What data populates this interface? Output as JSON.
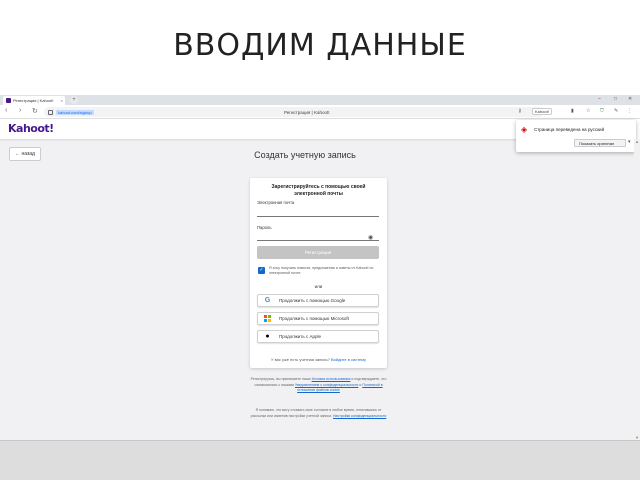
{
  "slide": {
    "title": "ВВОДИМ ДАННЫЕ"
  },
  "browser": {
    "tab_title": "Регистрация | Kahoot!",
    "tab_close": "×",
    "new_tab": "+",
    "url": "kahoot.com/signup",
    "page_title": "Регистрация | Kahoot!",
    "nav": {
      "back": "‹",
      "forward": "›",
      "reload": "↻"
    },
    "window_controls": {
      "minimize": "–",
      "maximize": "□",
      "close": "✕"
    },
    "extensions": {
      "translate_label": "Kahoot!"
    }
  },
  "header": {
    "logo": "Kahoot!"
  },
  "back_button": {
    "label": "← назад"
  },
  "main": {
    "heading": "Создать учетную запись"
  },
  "card": {
    "title": "Зарегистрируйтесь с помощью своей электронной почты",
    "email_label": "Электронная почта",
    "password_label": "Пароль",
    "submit_label": "Регистрация",
    "consent_text": "Я хочу получать новости, предложения и советы от Kahoot! по электронной почте.",
    "or_label": "или",
    "google_label": "Продолжить с помощью Google",
    "microsoft_label": "Продолжить с помощью Microsoft",
    "apple_label": "Продолжить с Apple",
    "login_prompt": "У вас уже есть учетная запись?",
    "login_link": "Войдите в систему"
  },
  "legal": {
    "p1_start": "Регистрируясь, вы принимаете наши",
    "p1_link1": "Условия использования",
    "p1_mid": "и подтверждаете, что ознакомились с нашими",
    "p1_link2": "Уведомлением о конфиденциальности",
    "p1_and": "и",
    "p1_link3": "Политикой в отношении файлов cookie",
    "p2_text": "Я понимаю, что могу отозвать свое согласие в любое время, отписавшись от рассылки или изменив настройки учетной записи.",
    "p2_link": "Настройки конфиденциальности"
  },
  "translate_popup": {
    "message": "Страница переведена на русский",
    "option": "Показать оригинал",
    "caret": "▾"
  },
  "colors": {
    "brand": "#46178f",
    "primary_blue": "#1368ce",
    "submit_disabled": "#c4c4c4"
  }
}
